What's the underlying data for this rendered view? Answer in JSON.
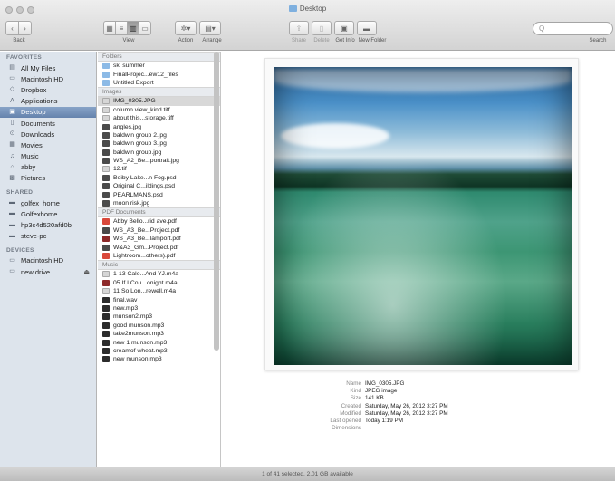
{
  "window": {
    "title": "Desktop"
  },
  "toolbar": {
    "back_label": "Back",
    "view_label": "View",
    "action_label": "Action",
    "arrange_label": "Arrange",
    "share_label": "Share",
    "delete_label": "Delete",
    "getinfo_label": "Get Info",
    "newfolder_label": "New Folder",
    "search_label": "Search",
    "search_value": "Q"
  },
  "sidebar": {
    "favorites_header": "FAVORITES",
    "favorites": [
      {
        "label": "All My Files",
        "icon": "all-files-icon",
        "glyph": "▤"
      },
      {
        "label": "Macintosh HD",
        "icon": "hard-drive-icon",
        "glyph": "▭"
      },
      {
        "label": "Dropbox",
        "icon": "dropbox-icon",
        "glyph": "◇"
      },
      {
        "label": "Applications",
        "icon": "applications-icon",
        "glyph": "A"
      },
      {
        "label": "Desktop",
        "icon": "desktop-icon",
        "glyph": "▣",
        "selected": true
      },
      {
        "label": "Documents",
        "icon": "documents-icon",
        "glyph": "▯"
      },
      {
        "label": "Downloads",
        "icon": "downloads-icon",
        "glyph": "⊙"
      },
      {
        "label": "Movies",
        "icon": "movies-icon",
        "glyph": "▦"
      },
      {
        "label": "Music",
        "icon": "music-icon",
        "glyph": "♫"
      },
      {
        "label": "abby",
        "icon": "home-icon",
        "glyph": "⌂"
      },
      {
        "label": "Pictures",
        "icon": "pictures-icon",
        "glyph": "▩"
      }
    ],
    "shared_header": "SHARED",
    "shared": [
      {
        "label": "golfex_home",
        "icon": "network-icon",
        "glyph": "▬"
      },
      {
        "label": "Golfexhome",
        "icon": "network-icon",
        "glyph": "▬"
      },
      {
        "label": "hp3c4d520afd0b",
        "icon": "printer-icon",
        "glyph": "▬"
      },
      {
        "label": "steve-pc",
        "icon": "pc-icon",
        "glyph": "▬"
      }
    ],
    "devices_header": "DEVICES",
    "devices": [
      {
        "label": "Macintosh HD",
        "icon": "hard-drive-icon",
        "glyph": "▭"
      },
      {
        "label": "new drive",
        "icon": "external-drive-icon",
        "glyph": "▭",
        "eject": "⏏"
      }
    ]
  },
  "files": {
    "folders_header": "Folders",
    "folders": [
      {
        "name": "ski summer",
        "kind": "folder"
      },
      {
        "name": "FinalProjec...ew12_files",
        "kind": "folder"
      },
      {
        "name": "Untitled Export",
        "kind": "folder"
      }
    ],
    "images_header": "Images",
    "images": [
      {
        "name": "IMG_0305.JPG",
        "kind": "img-light",
        "selected": true
      },
      {
        "name": "column view_kind.tiff",
        "kind": "img-light"
      },
      {
        "name": "about this...storage.tiff",
        "kind": "img-light"
      },
      {
        "name": "angles.jpg",
        "kind": "img"
      },
      {
        "name": "baldwin group 2.jpg",
        "kind": "img"
      },
      {
        "name": "baldwin group 3.jpg",
        "kind": "img"
      },
      {
        "name": "baldwin group.jpg",
        "kind": "img"
      },
      {
        "name": "WS_A2_Be...portrait.jpg",
        "kind": "img"
      },
      {
        "name": "12.tif",
        "kind": "img-light"
      },
      {
        "name": "Boiby Lake...n Fog.psd",
        "kind": "img"
      },
      {
        "name": "Original C...ildings.psd",
        "kind": "img"
      },
      {
        "name": "PEARLMANS.psd",
        "kind": "img"
      },
      {
        "name": "moon risk.jpg",
        "kind": "img"
      }
    ],
    "pdf_header": "PDF Documents",
    "pdfs": [
      {
        "name": "Abby Bello...rid ave.pdf",
        "kind": "pdf"
      },
      {
        "name": "WS_A3_Be...Project.pdf",
        "kind": "img"
      },
      {
        "name": "WS_A3_Be...lamport.pdf",
        "kind": "audio-img"
      },
      {
        "name": "W&A3_Gm...Project.pdf",
        "kind": "img"
      },
      {
        "name": "Lightroom...others).pdf",
        "kind": "pdf"
      }
    ],
    "music_header": "Music",
    "music": [
      {
        "name": "1-13 Calo...And YJ.m4a",
        "kind": "img-light"
      },
      {
        "name": "05 If I Cou...onight.m4a",
        "kind": "audio-img"
      },
      {
        "name": "11 So Lon...rewell.m4a",
        "kind": "img-light"
      },
      {
        "name": "final.wav",
        "kind": "audio"
      },
      {
        "name": "new.mp3",
        "kind": "audio"
      },
      {
        "name": "munson2.mp3",
        "kind": "audio"
      },
      {
        "name": "good munson.mp3",
        "kind": "audio"
      },
      {
        "name": "take2munson.mp3",
        "kind": "audio"
      },
      {
        "name": "new 1 munson.mp3",
        "kind": "audio"
      },
      {
        "name": "creamof wheat.mp3",
        "kind": "audio"
      },
      {
        "name": "new munson.mp3",
        "kind": "audio"
      }
    ]
  },
  "preview": {
    "info": [
      {
        "key": "Name",
        "value": "IMG_0305.JPG"
      },
      {
        "key": "Kind",
        "value": "JPEG image"
      },
      {
        "key": "Size",
        "value": "141 KB"
      },
      {
        "key": "Created",
        "value": "Saturday, May 26, 2012 3:27 PM"
      },
      {
        "key": "Modified",
        "value": "Saturday, May 26, 2012 3:27 PM"
      },
      {
        "key": "Last opened",
        "value": "Today 1:19 PM"
      },
      {
        "key": "Dimensions",
        "value": "--"
      }
    ]
  },
  "status": {
    "text": "1 of 41 selected, 2.01 GB available"
  }
}
